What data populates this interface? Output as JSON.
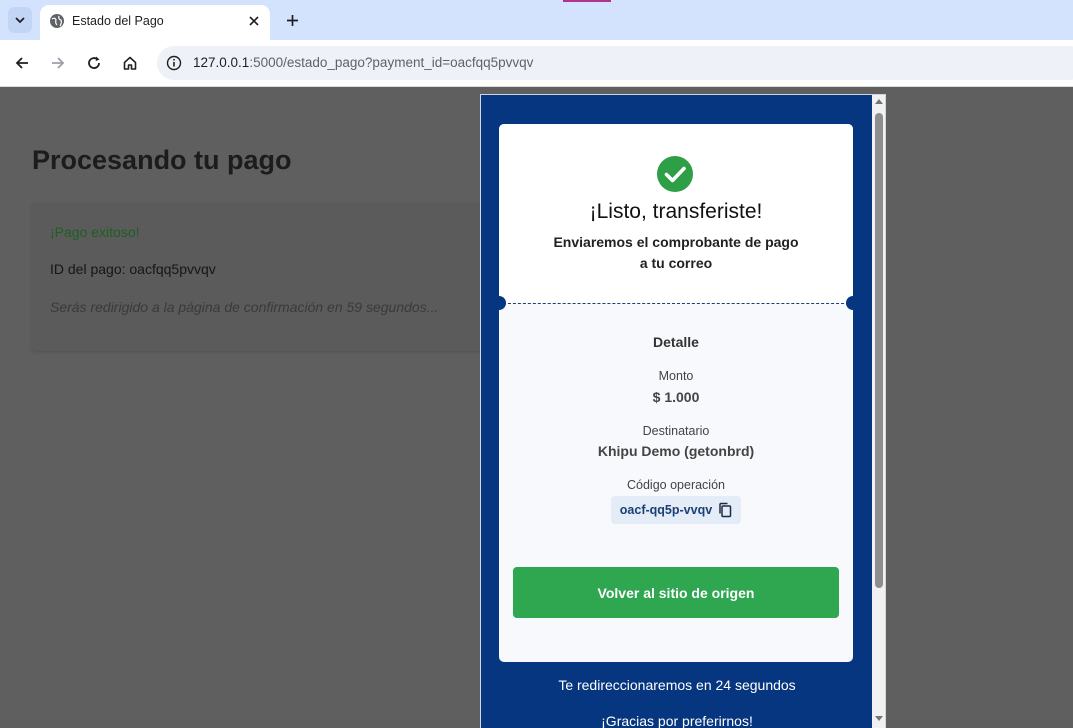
{
  "browser": {
    "tab_title": "Estado del Pago",
    "url_host": "127.0.0.1",
    "url_rest": ":5000/estado_pago?payment_id=oacfqq5pvvqv"
  },
  "page": {
    "heading": "Procesando tu pago",
    "status_success": "¡Pago exitoso!",
    "payment_id_line": "ID del pago: oacfqq5pvvqv",
    "redirect_notice": "Serás redirigido a la página de confirmación en 59 segundos..."
  },
  "modal": {
    "title": "¡Listo, transferiste!",
    "subtitle_line1": "Enviaremos el comprobante de pago",
    "subtitle_line2": "a tu correo",
    "detail_heading": "Detalle",
    "amount_label": "Monto",
    "amount_value": "$ 1.000",
    "recipient_label": "Destinatario",
    "recipient_value": "Khipu Demo (getonbrd)",
    "operation_label": "Código operación",
    "operation_code": "oacf-qq5p-vvqv",
    "button_label": "Volver al sitio de origen",
    "redirect_text": "Te redireccionaremos en 24 segundos",
    "thanks_text": "¡Gracias por preferirnos!"
  },
  "colors": {
    "modal_bg": "#06367f",
    "success_green": "#2fa650",
    "check_green": "#2e9e47",
    "tab_strip": "#d3e3fd"
  },
  "icons": [
    "chevron-down-icon",
    "globe-icon",
    "close-icon",
    "plus-icon",
    "back-arrow-icon",
    "forward-arrow-icon",
    "reload-icon",
    "home-icon",
    "info-icon",
    "check-circle-icon",
    "copy-icon"
  ]
}
